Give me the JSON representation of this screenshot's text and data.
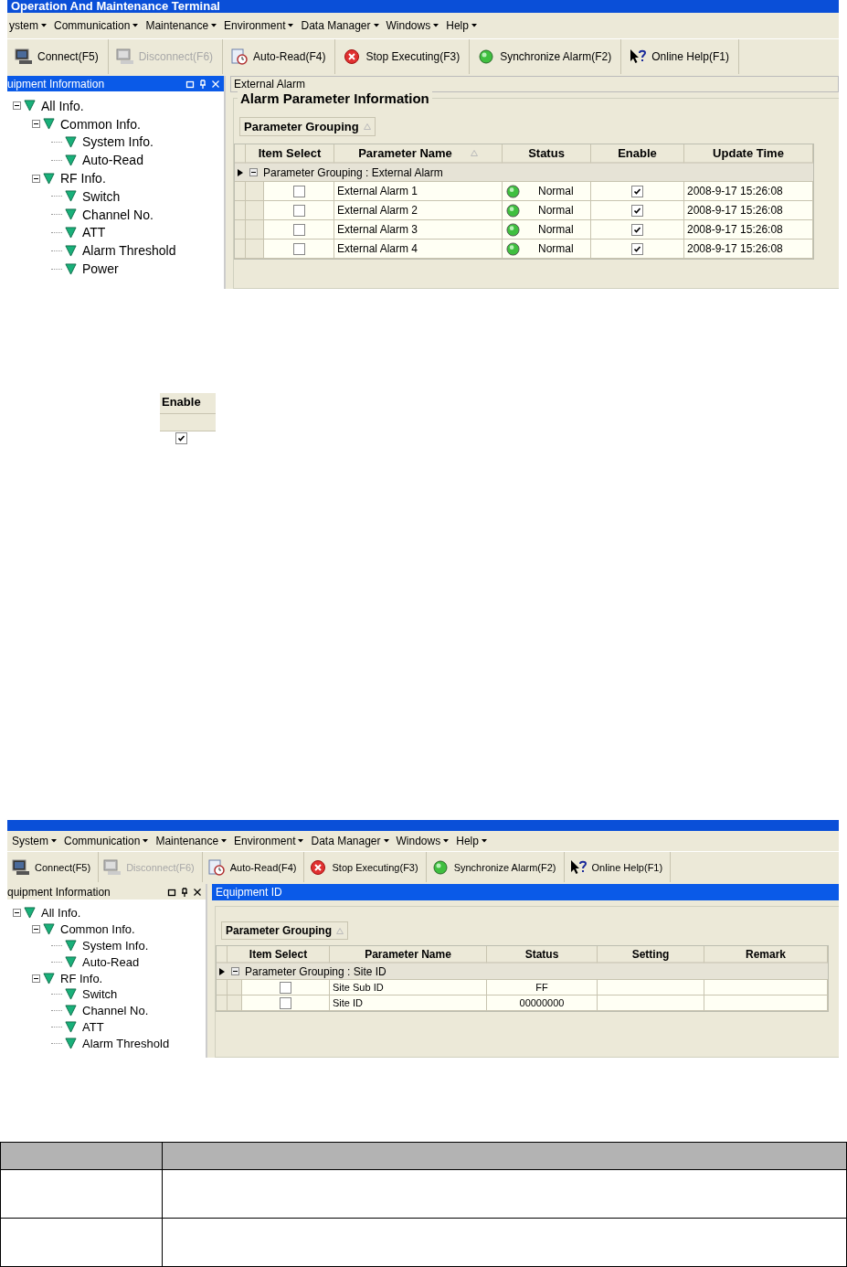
{
  "screenshots": [
    {
      "title": "Operation And Maintenance Terminal",
      "menu": [
        "ystem",
        "Communication",
        "Maintenance",
        "Environment",
        "Data Manager",
        "Windows",
        "Help"
      ],
      "toolbar": [
        {
          "label": "Connect(F5)",
          "disabled": false
        },
        {
          "label": "Disconnect(F6)",
          "disabled": true
        },
        {
          "label": "Auto-Read(F4)",
          "disabled": false
        },
        {
          "label": "Stop Executing(F3)",
          "disabled": false
        },
        {
          "label": "Synchronize Alarm(F2)",
          "disabled": false
        },
        {
          "label": "Online Help(F1)",
          "disabled": false
        }
      ],
      "pane_title": "uipment Information",
      "tree": [
        {
          "label": "All Info.",
          "expanded": true,
          "children": [
            {
              "label": "Common Info.",
              "expanded": true,
              "children": [
                {
                  "label": "System Info."
                },
                {
                  "label": "Auto-Read"
                }
              ]
            },
            {
              "label": "RF Info.",
              "expanded": true,
              "children": [
                {
                  "label": "Switch"
                },
                {
                  "label": "Channel No."
                },
                {
                  "label": "ATT"
                },
                {
                  "label": "Alarm Threshold"
                },
                {
                  "label": "Power"
                }
              ]
            }
          ]
        }
      ],
      "content_title": {
        "text": "External Alarm",
        "selected": false
      },
      "section_title": "Alarm Parameter Information",
      "grouping_button": "Parameter Grouping",
      "columns": [
        {
          "label": "Item Select",
          "sorted": false
        },
        {
          "label": "Parameter Name",
          "sorted": true
        },
        {
          "label": "Status",
          "sorted": false
        },
        {
          "label": "Enable",
          "sorted": false
        },
        {
          "label": "Update Time",
          "sorted": false
        }
      ],
      "group_row": {
        "text": "Parameter Grouping : External Alarm",
        "expanded": true
      },
      "rows": [
        [
          {
            "kind": "checkbox",
            "checked": false
          },
          {
            "kind": "text",
            "text": "External Alarm 1"
          },
          {
            "kind": "led",
            "text": "Normal"
          },
          {
            "kind": "checkbox",
            "checked": true
          },
          {
            "kind": "text",
            "text": "2008-9-17 15:26:08"
          }
        ],
        [
          {
            "kind": "checkbox",
            "checked": false
          },
          {
            "kind": "text",
            "text": "External Alarm 2"
          },
          {
            "kind": "led",
            "text": "Normal"
          },
          {
            "kind": "checkbox",
            "checked": true
          },
          {
            "kind": "text",
            "text": "2008-9-17 15:26:08"
          }
        ],
        [
          {
            "kind": "checkbox",
            "checked": false
          },
          {
            "kind": "text",
            "text": "External Alarm 3"
          },
          {
            "kind": "led",
            "text": "Normal"
          },
          {
            "kind": "checkbox",
            "checked": true
          },
          {
            "kind": "text",
            "text": "2008-9-17 15:26:08"
          }
        ],
        [
          {
            "kind": "checkbox",
            "checked": false
          },
          {
            "kind": "text",
            "text": "External Alarm 4"
          },
          {
            "kind": "led",
            "text": "Normal"
          },
          {
            "kind": "checkbox",
            "checked": true
          },
          {
            "kind": "text",
            "text": "2008-9-17 15:26:08"
          }
        ]
      ]
    },
    {
      "menu": [
        "System",
        "Communication",
        "Maintenance",
        "Environment",
        "Data Manager",
        "Windows",
        "Help"
      ],
      "toolbar": [
        {
          "label": "Connect(F5)",
          "disabled": false
        },
        {
          "label": "Disconnect(F6)",
          "disabled": true
        },
        {
          "label": "Auto-Read(F4)",
          "disabled": false
        },
        {
          "label": "Stop Executing(F3)",
          "disabled": false
        },
        {
          "label": "Synchronize Alarm(F2)",
          "disabled": false
        },
        {
          "label": "Online Help(F1)",
          "disabled": false
        }
      ],
      "pane_title": "quipment Information",
      "tree": [
        {
          "label": "All Info.",
          "expanded": true,
          "children": [
            {
              "label": "Common Info.",
              "expanded": true,
              "children": [
                {
                  "label": "System Info."
                },
                {
                  "label": "Auto-Read"
                }
              ]
            },
            {
              "label": "RF Info.",
              "expanded": true,
              "children": [
                {
                  "label": "Switch"
                },
                {
                  "label": "Channel No."
                },
                {
                  "label": "ATT"
                },
                {
                  "label": "Alarm Threshold"
                }
              ]
            }
          ]
        }
      ],
      "content_title": {
        "text": "Equipment ID",
        "selected": true
      },
      "grouping_button": "Parameter Grouping",
      "columns": [
        {
          "label": "Item Select",
          "sorted": false
        },
        {
          "label": "Parameter Name",
          "sorted": false
        },
        {
          "label": "Status",
          "sorted": false
        },
        {
          "label": "Setting",
          "sorted": false
        },
        {
          "label": "Remark",
          "sorted": false
        }
      ],
      "group_row": {
        "text": "Parameter Grouping : Site ID",
        "expanded": true
      },
      "rows": [
        [
          {
            "kind": "checkbox",
            "checked": false
          },
          {
            "kind": "text",
            "text": "Site Sub ID"
          },
          {
            "kind": "center",
            "text": "FF"
          },
          {
            "kind": "blank"
          },
          {
            "kind": "blank"
          }
        ],
        [
          {
            "kind": "checkbox",
            "checked": false
          },
          {
            "kind": "text",
            "text": "Site ID"
          },
          {
            "kind": "center",
            "text": "00000000"
          },
          {
            "kind": "blank"
          },
          {
            "kind": "blank"
          }
        ]
      ]
    }
  ],
  "enable_snippet": {
    "header": "Enable",
    "checked": true
  }
}
